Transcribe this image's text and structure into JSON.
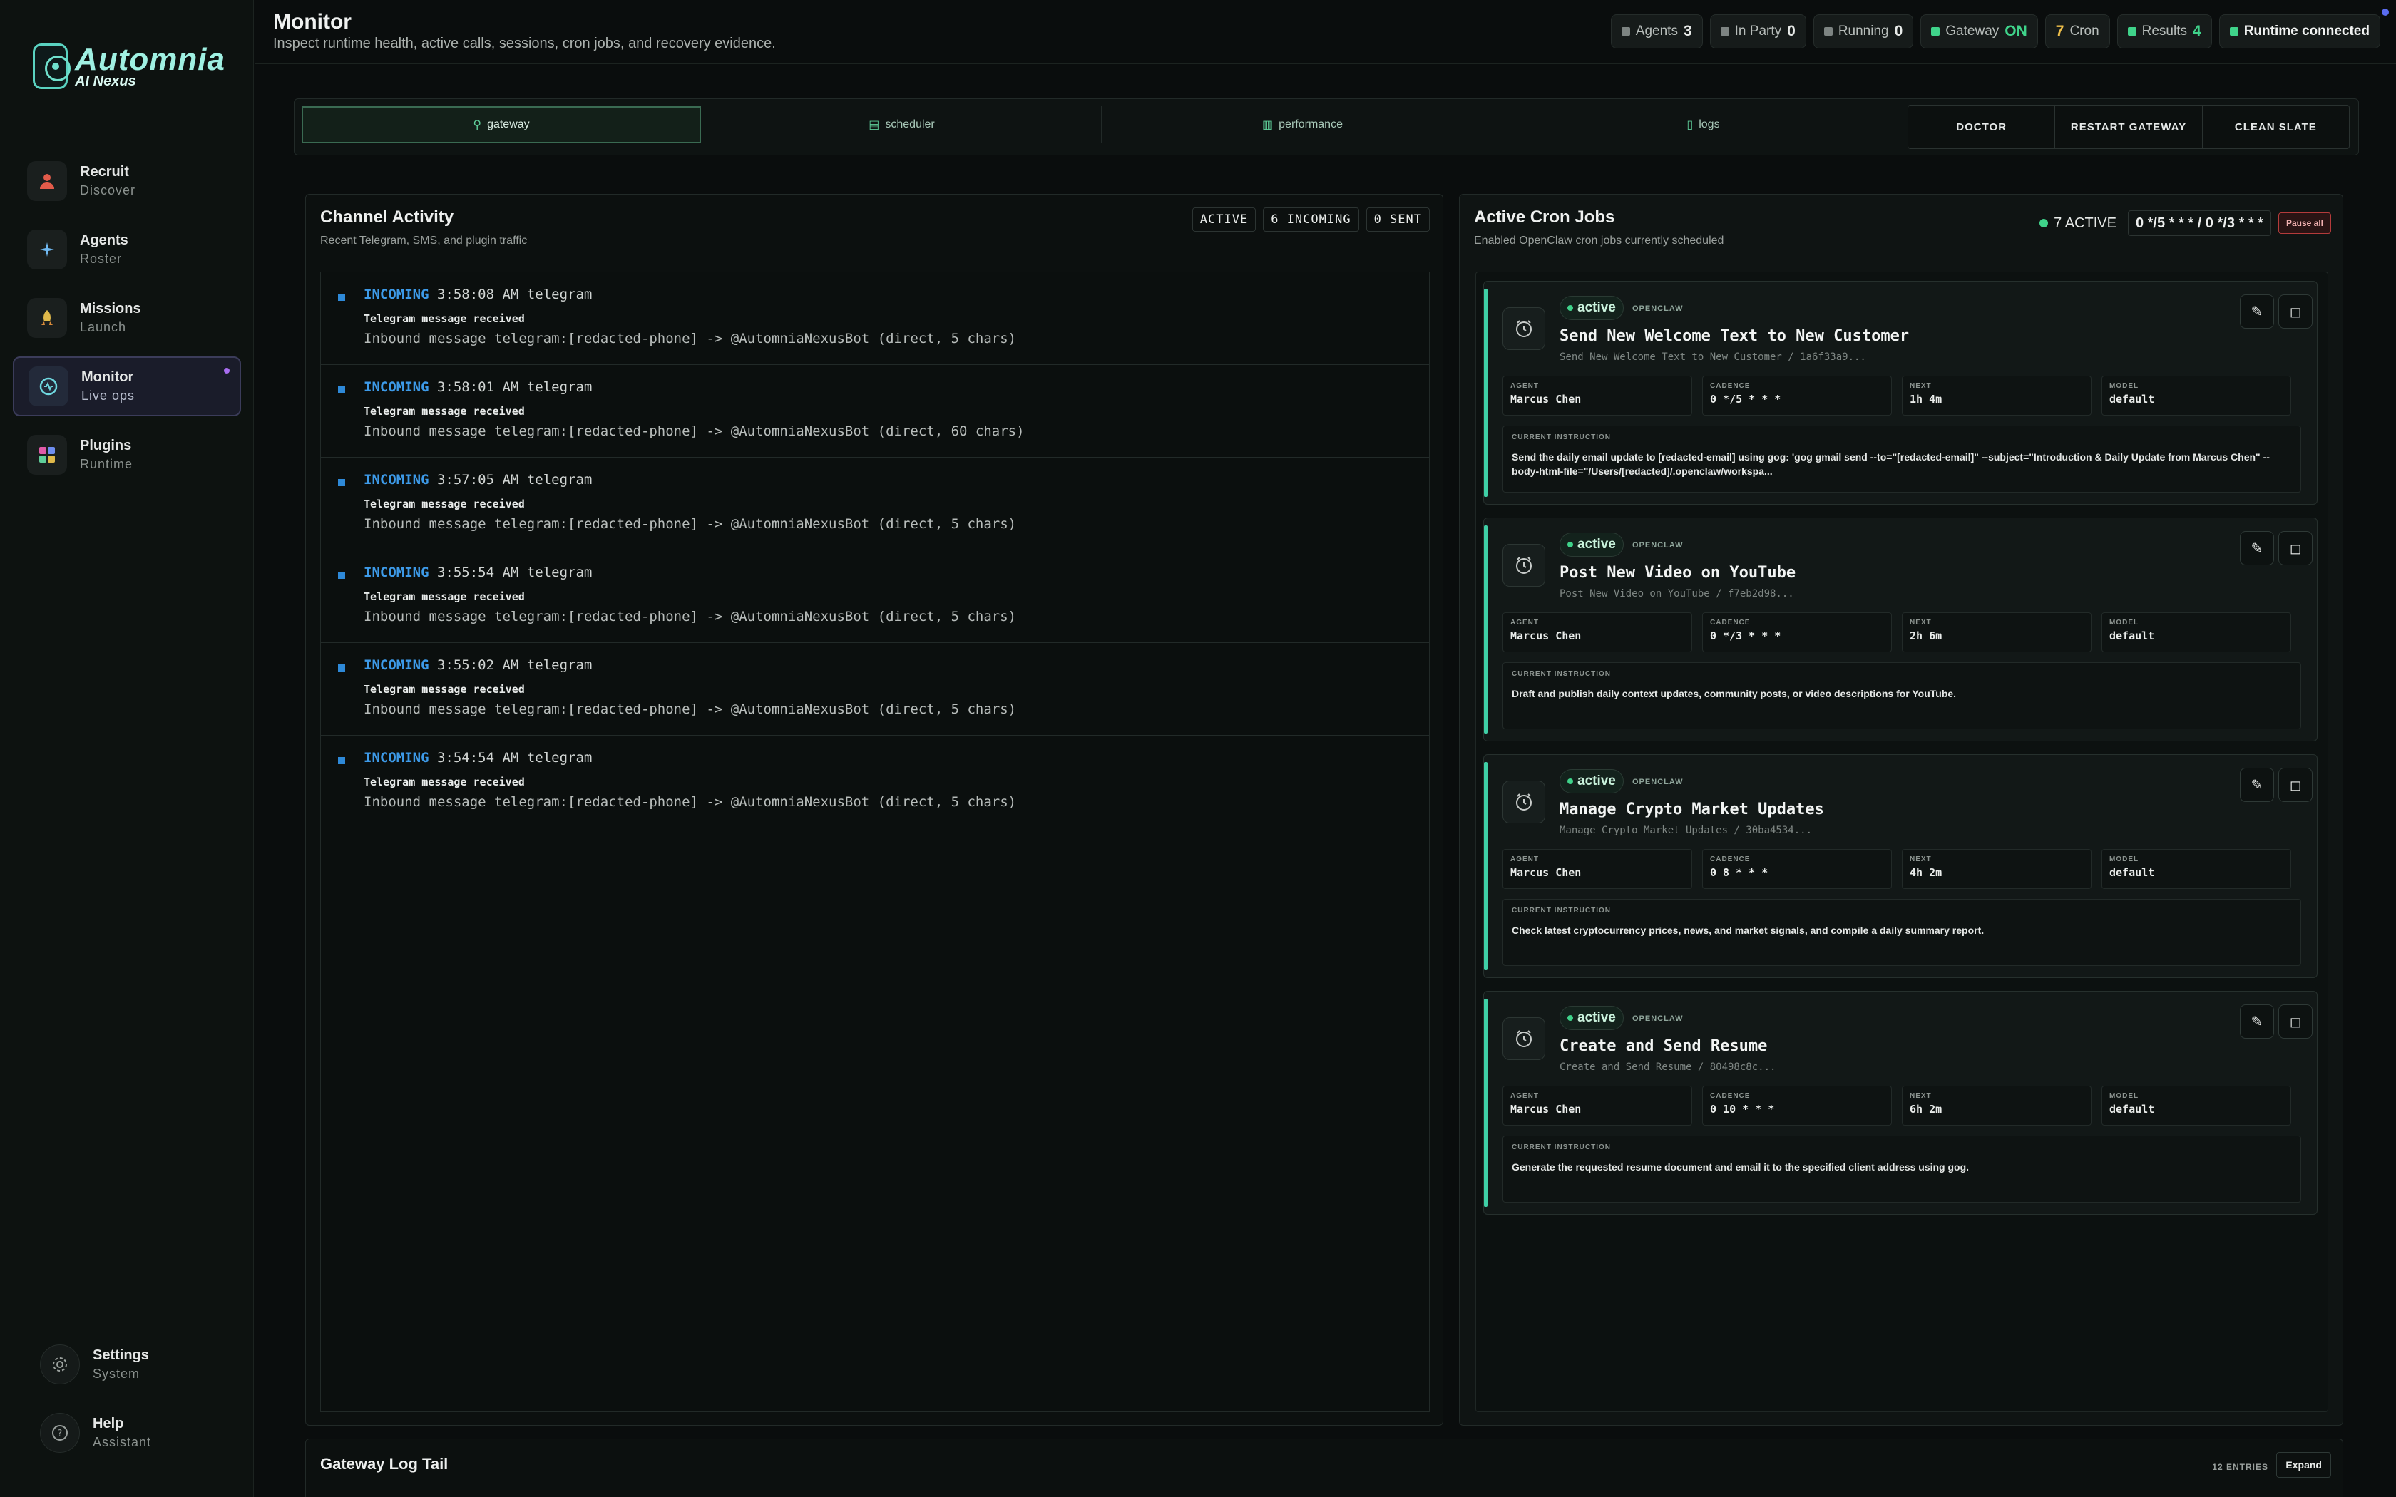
{
  "sidebar": {
    "logo": {
      "title": "Automnia",
      "subtitle": "AI Nexus"
    },
    "items": [
      {
        "label": "Recruit",
        "sub": "Discover",
        "icon": "person-icon"
      },
      {
        "label": "Agents",
        "sub": "Roster",
        "icon": "sparkle-icon"
      },
      {
        "label": "Missions",
        "sub": "Launch",
        "icon": "rocket-icon"
      },
      {
        "label": "Monitor",
        "sub": "Live ops",
        "icon": "monitor-icon"
      },
      {
        "label": "Plugins",
        "sub": "Runtime",
        "icon": "plugin-icon"
      }
    ],
    "bottom": [
      {
        "label": "Settings",
        "sub": "System"
      },
      {
        "label": "Help",
        "sub": "Assistant"
      }
    ]
  },
  "header": {
    "title": "Monitor",
    "subtitle": "Inspect runtime health, active calls, sessions, cron jobs, and recovery evidence.",
    "chips": [
      {
        "label": "Agents",
        "value": "3"
      },
      {
        "label": "In Party",
        "value": "0"
      },
      {
        "label": "Running",
        "value": "0"
      },
      {
        "label": "Gateway",
        "value": "ON"
      },
      {
        "label": "Cron",
        "value": "7"
      },
      {
        "label": "Results",
        "value": "4"
      },
      {
        "label": "Runtime connected"
      }
    ]
  },
  "tabs": [
    "gateway",
    "scheduler",
    "performance",
    "logs"
  ],
  "actions": [
    "DOCTOR",
    "RESTART GATEWAY",
    "CLEAN SLATE"
  ],
  "channel": {
    "title": "Channel Activity",
    "subtitle": "Recent Telegram, SMS, and plugin traffic",
    "badges": [
      "ACTIVE",
      "6 INCOMING",
      "0 SENT"
    ],
    "events": [
      {
        "dir": "INCOMING",
        "time": "3:58:08 AM",
        "channel": "telegram",
        "title": "Telegram message received",
        "detail": "Inbound message telegram:[redacted-phone] -> @AutomniaNexusBot (direct, 5 chars)"
      },
      {
        "dir": "INCOMING",
        "time": "3:58:01 AM",
        "channel": "telegram",
        "title": "Telegram message received",
        "detail": "Inbound message telegram:[redacted-phone] -> @AutomniaNexusBot (direct, 60 chars)"
      },
      {
        "dir": "INCOMING",
        "time": "3:57:05 AM",
        "channel": "telegram",
        "title": "Telegram message received",
        "detail": "Inbound message telegram:[redacted-phone] -> @AutomniaNexusBot (direct, 5 chars)"
      },
      {
        "dir": "INCOMING",
        "time": "3:55:54 AM",
        "channel": "telegram",
        "title": "Telegram message received",
        "detail": "Inbound message telegram:[redacted-phone] -> @AutomniaNexusBot (direct, 5 chars)"
      },
      {
        "dir": "INCOMING",
        "time": "3:55:02 AM",
        "channel": "telegram",
        "title": "Telegram message received",
        "detail": "Inbound message telegram:[redacted-phone] -> @AutomniaNexusBot (direct, 5 chars)"
      },
      {
        "dir": "INCOMING",
        "time": "3:54:54 AM",
        "channel": "telegram",
        "title": "Telegram message received",
        "detail": "Inbound message telegram:[redacted-phone] -> @AutomniaNexusBot (direct, 5 chars)"
      }
    ]
  },
  "cron": {
    "title": "Active Cron Jobs",
    "subtitle": "Enabled OpenClaw cron jobs currently scheduled",
    "active_label": "7 ACTIVE",
    "cadence_summary": "0 */5 * * * / 0 */3 * * *",
    "pause_label": "Pause all",
    "meta_keys": {
      "agent": "AGENT",
      "cadence": "CADENCE",
      "next": "NEXT",
      "model": "MODEL",
      "instruction": "CURRENT INSTRUCTION"
    },
    "jobs": [
      {
        "status": "active",
        "source": "OPENCLAW",
        "title": "Send New Welcome Text to New Customer",
        "id_line": "Send New Welcome Text to New Customer / 1a6f33a9...",
        "agent": "Marcus Chen",
        "cadence": "0 */5 * * *",
        "next": "1h 4m",
        "model": "default",
        "instruction": "Send the daily email update to [redacted-email] using gog: 'gog gmail send --to=\"[redacted-email]\" --subject=\"Introduction & Daily Update from Marcus Chen\" --body-html-file=\"/Users/[redacted]/.openclaw/workspa..."
      },
      {
        "status": "active",
        "source": "OPENCLAW",
        "title": "Post New Video on YouTube",
        "id_line": "Post New Video on YouTube / f7eb2d98...",
        "agent": "Marcus Chen",
        "cadence": "0 */3 * * *",
        "next": "2h 6m",
        "model": "default",
        "instruction": "Draft and publish daily context updates, community posts, or video descriptions for YouTube."
      },
      {
        "status": "active",
        "source": "OPENCLAW",
        "title": "Manage Crypto Market Updates",
        "id_line": "Manage Crypto Market Updates / 30ba4534...",
        "agent": "Marcus Chen",
        "cadence": "0 8 * * *",
        "next": "4h 2m",
        "model": "default",
        "instruction": "Check latest cryptocurrency prices, news, and market signals, and compile a daily summary report."
      },
      {
        "status": "active",
        "source": "OPENCLAW",
        "title": "Create and Send Resume",
        "id_line": "Create and Send Resume / 80498c8c...",
        "agent": "Marcus Chen",
        "cadence": "0 10 * * *",
        "next": "6h 2m",
        "model": "default",
        "instruction": "Generate the requested resume document and email it to the specified client address using gog."
      }
    ]
  },
  "log_tail": {
    "title": "Gateway Log Tail",
    "count": "12 ENTRIES",
    "expand": "Expand"
  },
  "colors": {
    "accent": "#3fd38a",
    "incoming": "#3d9ae8",
    "cron_bar": "#3fcfa6",
    "warning": "#b43b3b"
  }
}
